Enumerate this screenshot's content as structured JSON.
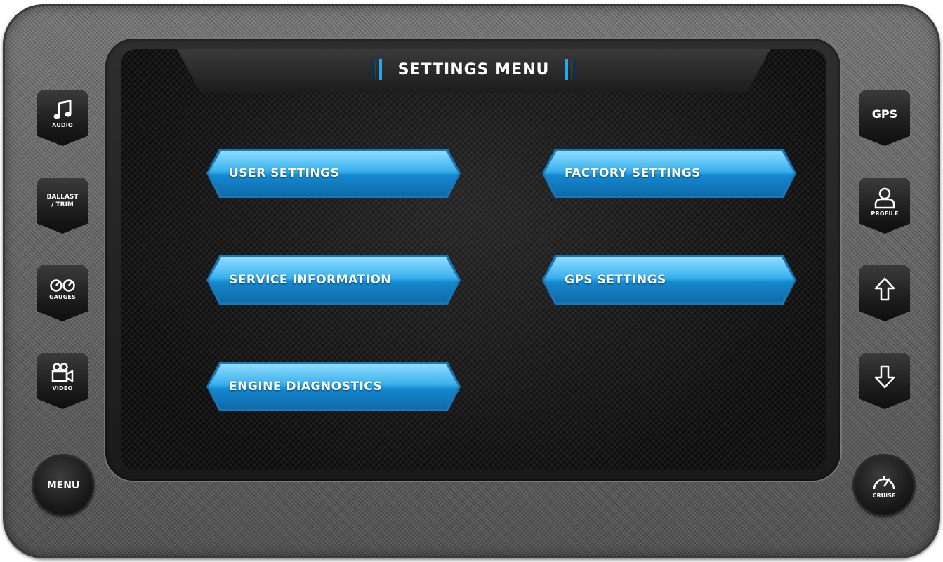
{
  "screen": {
    "title": "SETTINGS MENU"
  },
  "menu_buttons": [
    {
      "label": "USER SETTINGS"
    },
    {
      "label": "FACTORY SETTINGS"
    },
    {
      "label": "SERVICE INFORMATION"
    },
    {
      "label": "GPS SETTINGS"
    },
    {
      "label": "ENGINE DIAGNOSTICS"
    }
  ],
  "left_buttons": {
    "audio": {
      "label": "AUDIO",
      "icon": "music-note-icon"
    },
    "ballast": {
      "line1": "BALLAST",
      "line2": "/ TRIM"
    },
    "gauges": {
      "label": "GAUGES",
      "icon": "gauges-icon"
    },
    "video": {
      "label": "VIDEO",
      "icon": "video-camera-icon"
    },
    "menu": {
      "label": "MENU"
    }
  },
  "right_buttons": {
    "gps": {
      "label": "GPS"
    },
    "profile": {
      "label": "PROFILE",
      "icon": "profile-icon"
    },
    "up": {
      "icon": "arrow-up-icon"
    },
    "down": {
      "icon": "arrow-down-icon"
    },
    "cruise": {
      "label": "CRUISE",
      "icon": "speedometer-icon"
    }
  },
  "colors": {
    "accent_blue": "#27a7e8",
    "button_blue": "#1688cf"
  }
}
